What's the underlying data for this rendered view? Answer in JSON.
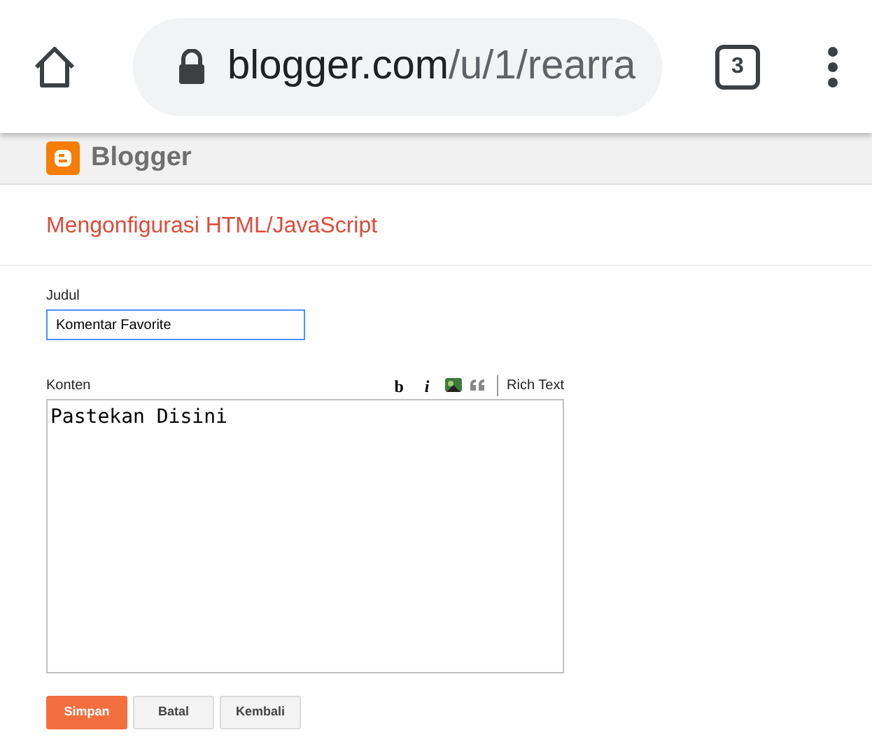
{
  "browser": {
    "url_host": "blogger.com",
    "url_path": "/u/1/rearra",
    "tab_count": "3"
  },
  "header": {
    "brand": "Blogger"
  },
  "page_title": "Mengonfigurasi HTML/JavaScript",
  "form": {
    "title_label": "Judul",
    "title_value": "Komentar Favorite",
    "content_label": "Konten",
    "toolbar": [
      {
        "kind": "text",
        "label": "b"
      },
      {
        "kind": "text",
        "label": "i"
      },
      {
        "kind": "image"
      },
      {
        "kind": "quote"
      }
    ],
    "mode_link": "Rich Text",
    "content_value": "Pastekan Disini"
  },
  "buttons": [
    {
      "label": "Simpan",
      "primary": true
    },
    {
      "label": "Batal",
      "primary": false
    },
    {
      "label": "Kembali",
      "primary": false
    }
  ]
}
